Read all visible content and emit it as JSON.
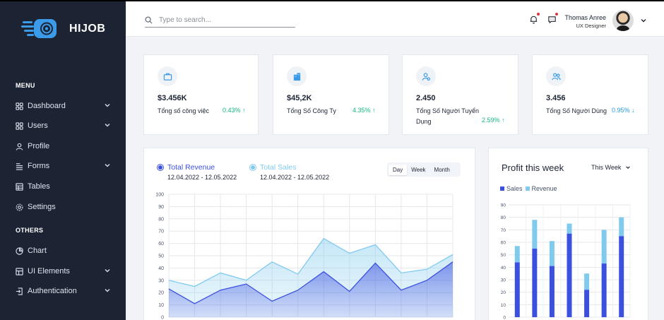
{
  "brand": {
    "name": "HIJOB"
  },
  "sidebar": {
    "menu_heading": "MENU",
    "others_heading": "OTHERS",
    "items": [
      {
        "label": "Dashboard",
        "icon": "grid-icon",
        "has_submenu": true
      },
      {
        "label": "Users",
        "icon": "grid-icon",
        "has_submenu": true
      },
      {
        "label": "Profile",
        "icon": "user-icon",
        "has_submenu": false
      },
      {
        "label": "Forms",
        "icon": "list-icon",
        "has_submenu": true
      },
      {
        "label": "Tables",
        "icon": "table-icon",
        "has_submenu": false
      },
      {
        "label": "Settings",
        "icon": "gear-icon",
        "has_submenu": false
      }
    ],
    "others_items": [
      {
        "label": "Chart",
        "icon": "pie-icon",
        "has_submenu": false
      },
      {
        "label": "UI Elements",
        "icon": "layers-icon",
        "has_submenu": true
      },
      {
        "label": "Authentication",
        "icon": "login-icon",
        "has_submenu": true
      }
    ]
  },
  "header": {
    "search_placeholder": "Type to search...",
    "user_name": "Thomas Anree",
    "user_role": "UX Designer"
  },
  "stats": [
    {
      "value": "$3.456K",
      "label": "Tổng số công việc",
      "change": "0.43%",
      "direction": "up",
      "icon": "briefcase-icon"
    },
    {
      "value": "$45,2K",
      "label": "Tổng Số Công Ty",
      "change": "4.35%",
      "direction": "up",
      "icon": "building-icon"
    },
    {
      "value": "2.450",
      "label": "Tổng Số Người Tuyển Dụng",
      "change": "2.59%",
      "direction": "up",
      "icon": "user-gear-icon"
    },
    {
      "value": "3.456",
      "label": "Tổng Số Người Dùng",
      "change": "0.95%",
      "direction": "down",
      "icon": "users-icon"
    }
  ],
  "revenue_chart": {
    "legend": [
      {
        "name": "Total Revenue",
        "dates": "12.04.2022 - 12.05.2022",
        "color": "#3c50e0"
      },
      {
        "name": "Total Sales",
        "dates": "12.04.2022 - 12.05.2022",
        "color": "#80caee"
      }
    ],
    "periods": [
      "Day",
      "Week",
      "Month"
    ],
    "active_period": "Day"
  },
  "profit_chart": {
    "title": "Profit this week",
    "selector": "This Week",
    "legend": [
      {
        "name": "Sales",
        "color": "#3c50e0"
      },
      {
        "name": "Revenue",
        "color": "#80caee"
      }
    ]
  },
  "chart_data": [
    {
      "type": "area",
      "ylim": [
        0,
        100
      ],
      "yticks": [
        0,
        10,
        20,
        30,
        40,
        50,
        60,
        70,
        80,
        90,
        100
      ],
      "series": [
        {
          "name": "Total Revenue",
          "values": [
            23,
            11,
            22,
            27,
            13,
            22,
            37,
            21,
            44,
            22,
            30,
            45
          ]
        },
        {
          "name": "Total Sales",
          "values": [
            30,
            25,
            36,
            30,
            45,
            35,
            64,
            52,
            59,
            36,
            39,
            51
          ]
        }
      ],
      "grid": true
    },
    {
      "type": "bar",
      "stacked": true,
      "ylim": [
        0,
        90
      ],
      "yticks": [
        0,
        10,
        20,
        30,
        40,
        50,
        60,
        70,
        80,
        90
      ],
      "series": [
        {
          "name": "Sales",
          "values": [
            44,
            55,
            41,
            67,
            22,
            43,
            65
          ]
        },
        {
          "name": "Revenue",
          "values": [
            13,
            23,
            20,
            8,
            13,
            27,
            15
          ]
        }
      ],
      "grid": true
    }
  ]
}
